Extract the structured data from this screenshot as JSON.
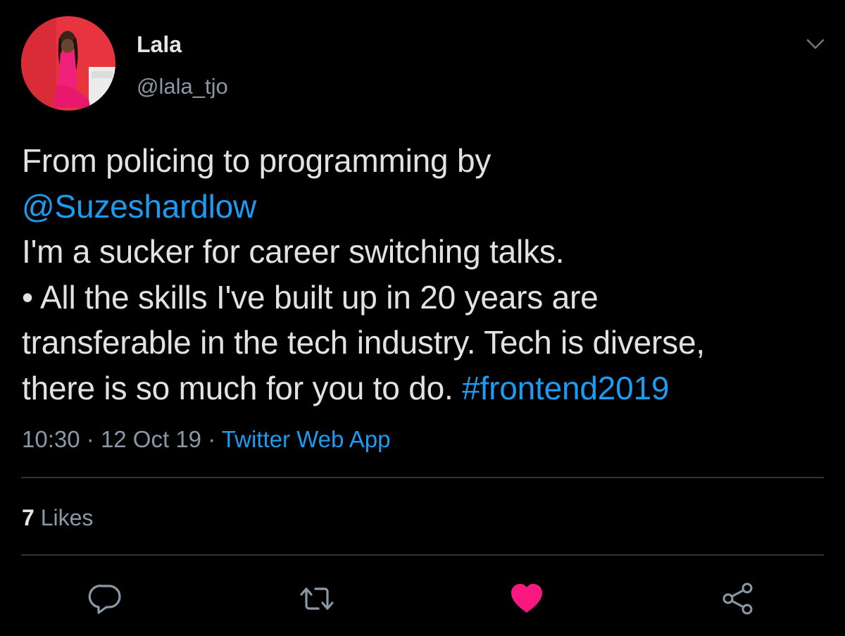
{
  "author": {
    "display_name": "Lala",
    "handle": "@lala_tjo"
  },
  "tweet": {
    "line1": "From policing to programming by",
    "mention": "@Suzeshardlow",
    "line3": "I'm a sucker for career switching talks.",
    "line4": "• All the skills I've built up in 20 years are",
    "line5": "transferable in the tech industry. Tech is diverse,",
    "line6_text": "there is so much for you to do. ",
    "hashtag": "#frontend2019"
  },
  "meta": {
    "time": "10:30",
    "separator": "·",
    "date": "12 Oct 19",
    "source": "Twitter Web App"
  },
  "stats": {
    "likes_count": "7",
    "likes_label": "Likes"
  },
  "actions": {
    "reply_icon": "reply-icon",
    "retweet_icon": "retweet-icon",
    "like_icon": "heart-icon",
    "share_icon": "share-icon",
    "liked": true
  },
  "colors": {
    "background": "#000000",
    "accent": "#1d9bf0",
    "like": "#f91880",
    "secondary_text": "#8b98a5"
  }
}
